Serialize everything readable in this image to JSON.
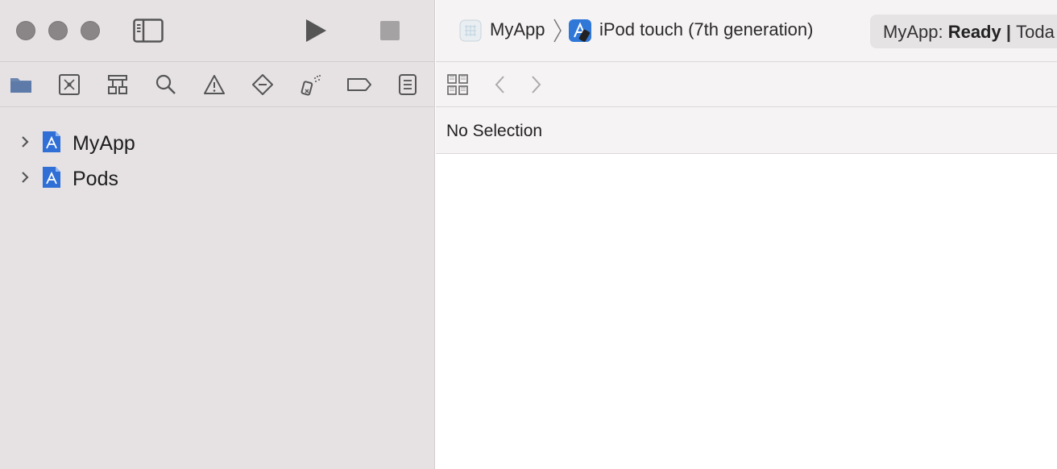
{
  "toolbar": {
    "window_controls": [
      "close-button",
      "minimize-button",
      "zoom-button"
    ],
    "sidebar_toggle_icon": "sidebar-icon",
    "run_icon": "play-icon",
    "stop_icon": "stop-icon"
  },
  "navigator_tabs": [
    {
      "icon": "folder-icon"
    },
    {
      "icon": "source-control-icon"
    },
    {
      "icon": "symbol-hierarchy-icon"
    },
    {
      "icon": "search-icon"
    },
    {
      "icon": "warning-icon"
    },
    {
      "icon": "test-diamond-icon"
    },
    {
      "icon": "debug-spray-icon"
    },
    {
      "icon": "breakpoint-tag-icon"
    },
    {
      "icon": "report-list-icon"
    }
  ],
  "project_tree": [
    {
      "label": "MyApp"
    },
    {
      "label": "Pods"
    }
  ],
  "breadcrumb": {
    "scheme": "MyApp",
    "device": "iPod touch (7th generation)"
  },
  "status": {
    "prefix": "MyApp: ",
    "state": "Ready",
    "separator": " | ",
    "suffix": "Toda"
  },
  "editor": {
    "no_selection": "No Selection"
  },
  "colors": {
    "sidebar_bg": "#e6e2e4",
    "toolbar_bg": "#f6f3f4",
    "accent_blue": "#2f6fd6",
    "folder_blue": "#6a85b0"
  }
}
